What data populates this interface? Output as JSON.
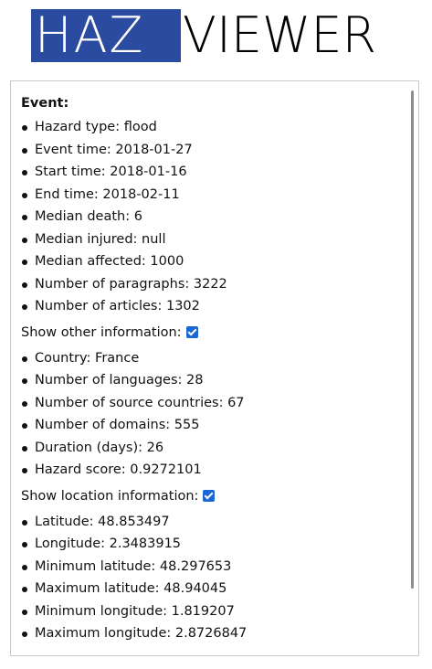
{
  "logo": {
    "left_text": "HAZ",
    "right_text": "VIEWER",
    "box_color": "#2a4ba0"
  },
  "event": {
    "heading": "Event:",
    "items": [
      "Hazard type: flood",
      "Event time: 2018-01-27",
      "Start time: 2018-01-16",
      "End time: 2018-02-11",
      "Median death: 6",
      "Median injured: null",
      "Median affected: 1000",
      "Number of paragraphs: 3222",
      "Number of articles: 1302"
    ]
  },
  "other_info": {
    "label": "Show other information:",
    "checked": true,
    "items": [
      "Country: France",
      "Number of languages: 28",
      "Number of source countries: 67",
      "Number of domains: 555",
      "Duration (days): 26",
      "Hazard score: 0.9272101"
    ]
  },
  "location_info": {
    "label": "Show location information:",
    "checked": true,
    "items": [
      "Latitude: 48.853497",
      "Longitude: 2.3483915",
      "Minimum latitude: 48.297653",
      "Maximum latitude: 48.94045",
      "Minimum longitude: 1.819207",
      "Maximum longitude: 2.8726847"
    ]
  },
  "colors": {
    "checkbox": "#1a66d2",
    "scrollbar": "#8e8e8e"
  }
}
